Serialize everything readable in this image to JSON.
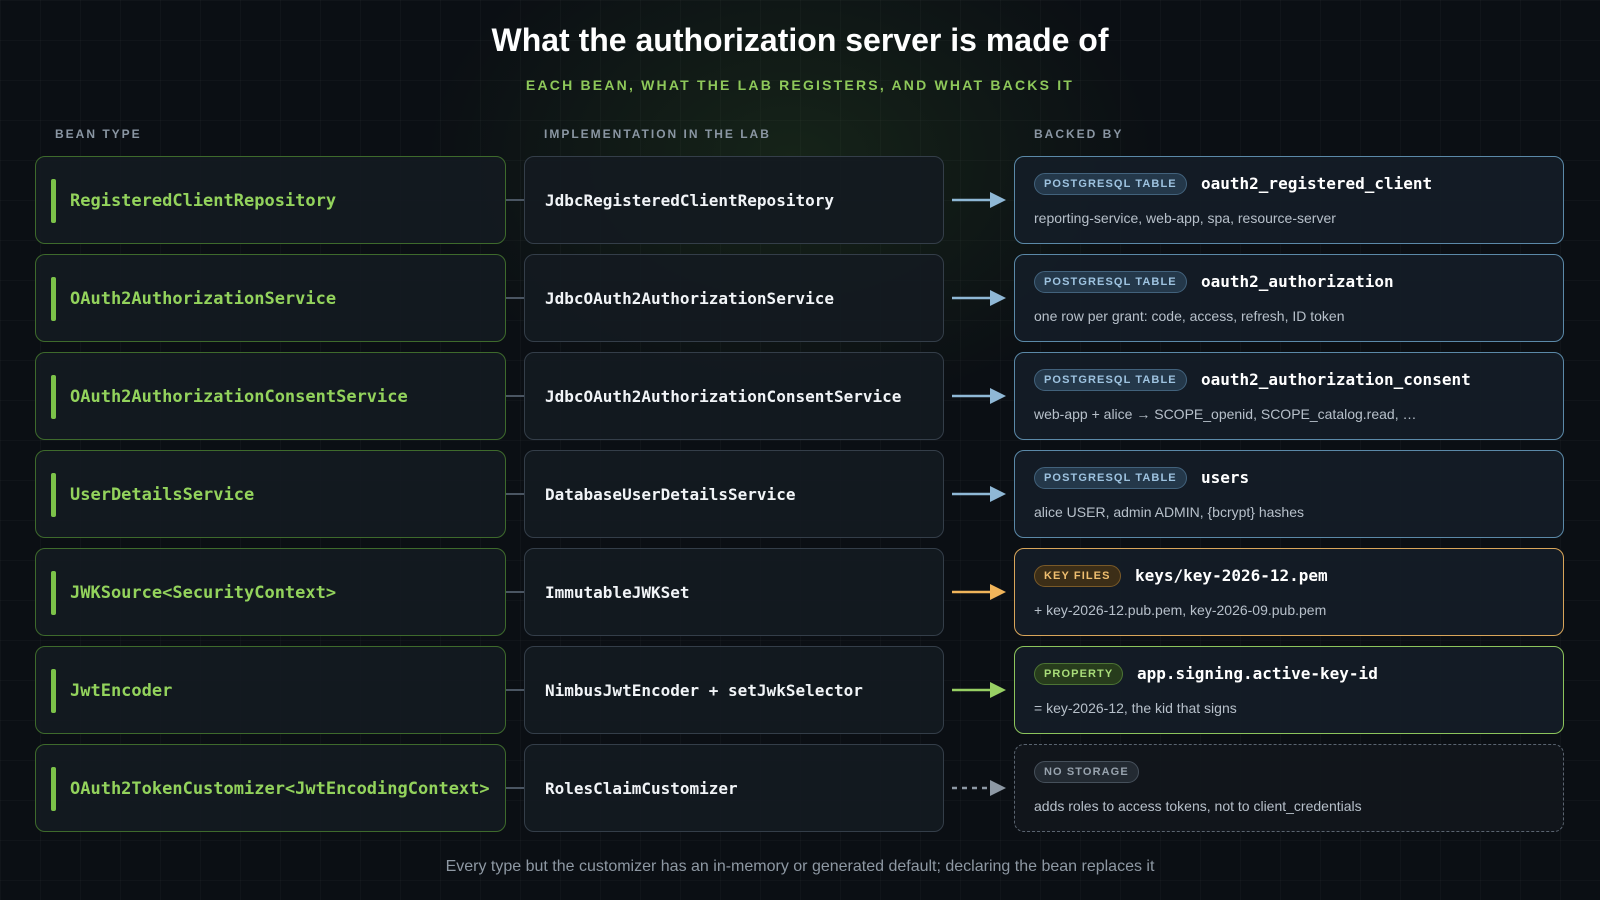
{
  "title": "What the authorization server is made of",
  "subtitle": "EACH BEAN, WHAT THE LAB REGISTERS, AND WHAT BACKS IT",
  "columns": {
    "type": "BEAN TYPE",
    "impl": "IMPLEMENTATION IN THE LAB",
    "backed": "BACKED BY"
  },
  "rows": [
    {
      "type": "RegisteredClientRepository",
      "impl": "JdbcRegisteredClientRepository",
      "backing_kind": "postgres",
      "badge": "POSTGRESQL TABLE",
      "name": "oauth2_registered_client",
      "desc": "reporting-service, web-app, spa, resource-server"
    },
    {
      "type": "OAuth2AuthorizationService",
      "impl": "JdbcOAuth2AuthorizationService",
      "backing_kind": "postgres",
      "badge": "POSTGRESQL TABLE",
      "name": "oauth2_authorization",
      "desc": "one row per grant: code, access, refresh, ID token"
    },
    {
      "type": "OAuth2AuthorizationConsentService",
      "impl": "JdbcOAuth2AuthorizationConsentService",
      "backing_kind": "postgres",
      "badge": "POSTGRESQL TABLE",
      "name": "oauth2_authorization_consent",
      "desc": "web-app + alice → SCOPE_openid, SCOPE_catalog.read, …"
    },
    {
      "type": "UserDetailsService",
      "impl": "DatabaseUserDetailsService",
      "backing_kind": "postgres",
      "badge": "POSTGRESQL TABLE",
      "name": "users",
      "desc": "alice USER, admin ADMIN, {bcrypt} hashes"
    },
    {
      "type": "JWKSource<SecurityContext>",
      "impl": "ImmutableJWKSet",
      "backing_kind": "keys",
      "badge": "KEY FILES",
      "name": "keys/key-2026-12.pem",
      "desc": "+ key-2026-12.pub.pem, key-2026-09.pub.pem"
    },
    {
      "type": "JwtEncoder",
      "impl": "NimbusJwtEncoder + setJwkSelector",
      "backing_kind": "prop",
      "badge": "PROPERTY",
      "name": "app.signing.active-key-id",
      "desc": "= key-2026-12, the kid that signs"
    },
    {
      "type": "OAuth2TokenCustomizer<JwtEncodingContext>",
      "impl": "RolesClaimCustomizer",
      "backing_kind": "nostore",
      "badge": "NO STORAGE",
      "name": "",
      "desc": "adds roles to access tokens, not to client_credentials"
    }
  ],
  "colors": {
    "postgres": "#8fb8d6",
    "keys": "#f0b45a",
    "prop": "#98d064",
    "nostore": "#8d98a4"
  },
  "footer": "Every type but the customizer has an in-memory or generated default; declaring the bean replaces it"
}
